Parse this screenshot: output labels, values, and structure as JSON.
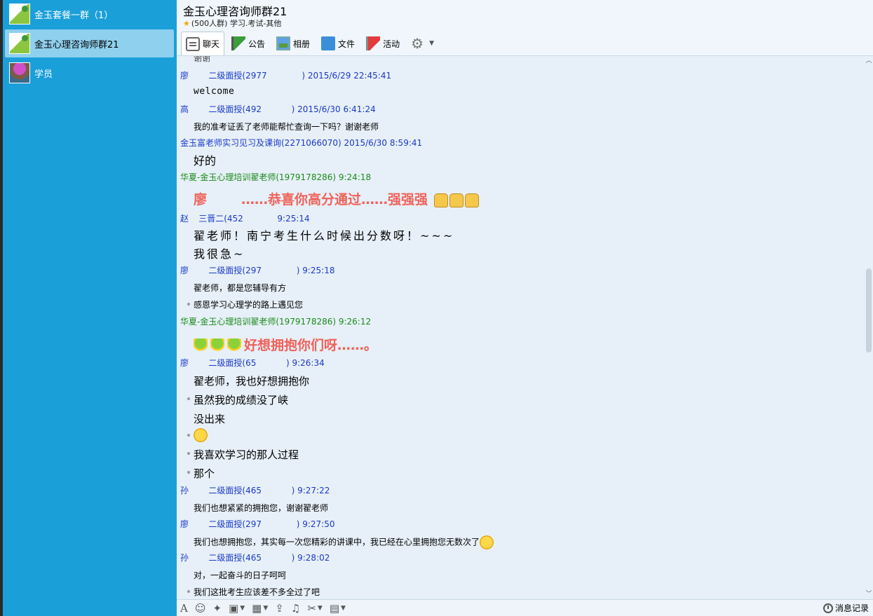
{
  "sidebar": {
    "conversations": [
      {
        "name": "金玉套餐一群（1）",
        "avatar": "group-logo-icon",
        "active": false
      },
      {
        "name": "金玉心理咨询师群21",
        "avatar": "group-logo-icon",
        "active": true
      },
      {
        "name": "学员",
        "avatar": "user-photo-icon",
        "active": false
      }
    ]
  },
  "header": {
    "title": "金玉心理咨询师群21",
    "info": "(500人群) 学习.考试-其他"
  },
  "toolbar": {
    "tabs": [
      {
        "label": "聊天",
        "icon": "chat-icon"
      },
      {
        "label": "公告",
        "icon": "notice-flag-icon"
      },
      {
        "label": "相册",
        "icon": "album-icon"
      },
      {
        "label": "文件",
        "icon": "folder-icon"
      },
      {
        "label": "活动",
        "icon": "event-flag-icon"
      }
    ]
  },
  "messages": {
    "clipped_top": "谢谢",
    "m1": {
      "sender": "廖",
      "sender_rest": "二级面授(2977",
      "time": ") 2015/6/29 22:45:41",
      "lines": [
        "welcome"
      ]
    },
    "m2": {
      "sender": "高",
      "sender_rest": "二级面授(492",
      "time": ") 2015/6/30 6:41:24",
      "lines": [
        "我的准考证丢了老师能帮忙查询一下吗？谢谢老师"
      ]
    },
    "m3": {
      "sender": "金玉富老师实习见习及课询(2271066070)",
      "time": " 2015/6/30 8:59:41",
      "lines": [
        "好的"
      ]
    },
    "m4": {
      "sender": "华夏-金玉心理培训翟老师(1979178286)",
      "time": "  9:24:18",
      "lines": [
        "廖",
        "……恭喜你高分通过……强强强"
      ]
    },
    "m5": {
      "sender": "赵",
      "sender_rest": "三晋二(452",
      "time": "9:25:14",
      "lines": [
        "翟老师！南宁考生什么时候出分数呀！~~~",
        "我很急~"
      ]
    },
    "m6": {
      "sender": "廖",
      "sender_rest": "二级面授(297",
      "time": ") 9:25:18",
      "lines": [
        "翟老师，都是您辅导有方",
        "感恩学习心理学的路上遇见您"
      ]
    },
    "m7": {
      "sender": "华夏-金玉心理培训翟老师(1979178286)",
      "time": "  9:26:12",
      "lines": [
        "好想拥抱你们呀……。"
      ]
    },
    "m8": {
      "sender": "廖",
      "sender_rest": "二级面授(65",
      "time": ") 9:26:34",
      "lines": [
        "翟老师，我也好想拥抱你",
        "虽然我的成绩没了峡",
        "没出来",
        "我喜欢学习的那人过程",
        "那个"
      ]
    },
    "m9": {
      "sender": "孙",
      "sender_rest": "二级面授(465",
      "time": ") 9:27:22",
      "lines": [
        "我们也想紧紧的拥抱您，谢谢翟老师"
      ]
    },
    "m10": {
      "sender": "廖",
      "sender_rest": "二级面授(297",
      "time": ") 9:27:50",
      "lines": [
        "我们也想拥抱您，其实每一次您精彩的讲课中，我已经在心里拥抱您无数次了"
      ]
    },
    "m11": {
      "sender": "孙",
      "sender_rest": "二级面授(465",
      "time": ") 9:28:02",
      "lines": [
        "对，一起奋斗的日子呵呵",
        "我们这批考生应该差不多全过了吧"
      ]
    }
  },
  "input_bar": {
    "icons": [
      "font-icon",
      "emoji-icon",
      "magic-wand-icon",
      "screenshot-icon",
      "image-icon",
      "upload-icon",
      "music-icon",
      "scissors-icon",
      "more-icon"
    ],
    "history_label": "消息记录"
  },
  "colors": {
    "sidebar": "#1a9fd9",
    "active_item": "#8fd0ee",
    "sender_blue": "#1a39c8",
    "sender_green": "#1a8a1a",
    "highlight_red": "#f0625a"
  }
}
